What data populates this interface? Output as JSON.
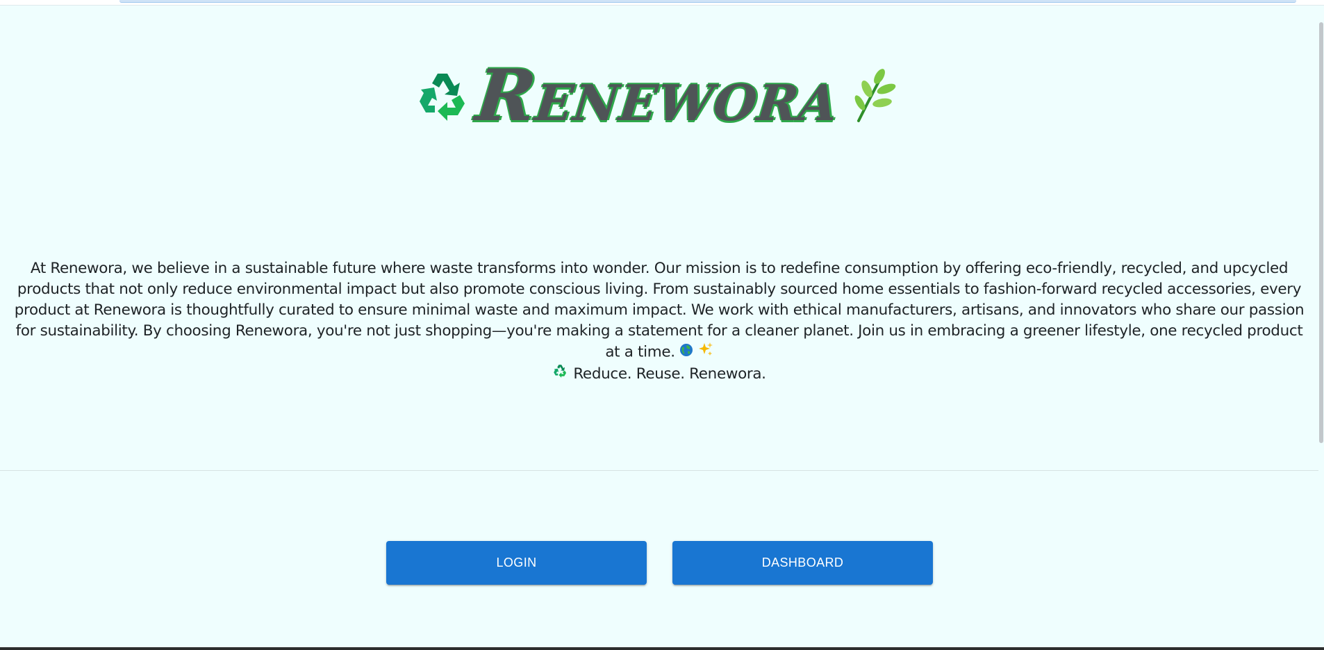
{
  "header": {
    "brand_name": "Renewora",
    "left_icon": "recycle-icon",
    "right_icon": "herb-icon"
  },
  "about": {
    "paragraph": "At Renewora, we believe in a sustainable future where waste transforms into wonder. Our mission is to redefine consumption by offering eco-friendly, recycled, and upcycled products that not only reduce environmental impact but also promote conscious living. From sustainably sourced home essentials to fashion-forward recycled accessories, every product at Renewora is thoughtfully curated to ensure minimal waste and maximum impact. We work with ethical manufacturers, artisans, and innovators who share our passion for sustainability. By choosing Renewora, you're not just shopping—you're making a statement for a cleaner planet. Join us in embracing a greener lifestyle, one recycled product at a time.",
    "paragraph_end_icons": [
      "globe-icon",
      "sparkles-icon"
    ],
    "tagline": "Reduce. Reuse. Renewora.",
    "tagline_icon": "recycle-icon"
  },
  "actions": {
    "login_label": "LOGIN",
    "dashboard_label": "DASHBOARD"
  },
  "colors": {
    "background": "#effefe",
    "button": "#1976d2",
    "brand_text": "#4f5457",
    "brand_outline": "#2ea84a",
    "recycle_green": "#1db954"
  }
}
